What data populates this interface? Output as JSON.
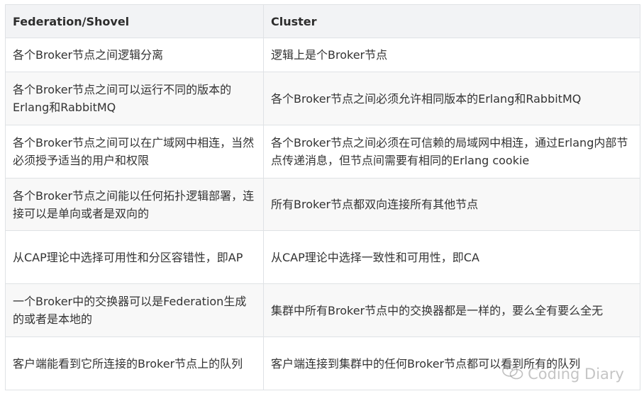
{
  "table": {
    "headers": [
      "Federation/Shovel",
      "Cluster"
    ],
    "rows": [
      [
        "各个Broker节点之间逻辑分离",
        "逻辑上是个Broker节点"
      ],
      [
        "各个Broker节点之间可以运行不同的版本的Erlang和RabbitMQ",
        "各个Broker节点之间必须允许相同版本的Erlang和RabbitMQ"
      ],
      [
        "各个Broker节点之间可以在广域网中相连，当然必须授予适当的用户和权限",
        "各个Broker节点之间必须在可信赖的局域网中相连，通过Erlang内部节点传递消息，但节点间需要有相同的Erlang cookie"
      ],
      [
        "各个Broker节点之间能以任何拓扑逻辑部署，连接可以是单向或者是双向的",
        "所有Broker节点都双向连接所有其他节点"
      ],
      [
        "从CAP理论中选择可用性和分区容错性，即AP",
        "从CAP理论中选择一致性和可用性，即CA"
      ],
      [
        "一个Broker中的交换器可以是Federation生成的或者是本地的",
        "集群中所有Broker节点中的交换器都是一样的，要么全有要么全无"
      ],
      [
        "客户端能看到它所连接的Broker节点上的队列",
        "客户端连接到集群中的任何Broker节点都可以看到所有的队列"
      ]
    ]
  },
  "watermark": {
    "text": "Coding Diary",
    "icon": "wechat-icon"
  }
}
